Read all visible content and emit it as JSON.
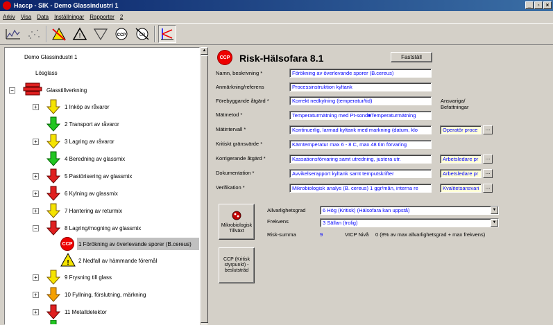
{
  "window": {
    "title": "Haccp - SIK - Demo Glassindustri 1"
  },
  "menu": [
    "Arkiv",
    "Visa",
    "Data",
    "Inställningar",
    "Rapporter",
    "2"
  ],
  "toolbar": {
    "icons": [
      "chart-icon",
      "scatter-icon",
      "no-warning-icon",
      "warning-icon",
      "triangle-icon",
      "ccp-icon",
      "no-ccp-icon",
      "ccp-split-icon"
    ]
  },
  "tree": {
    "root": "Demo Glassindustri 1",
    "product": "Lösglass",
    "process": "Glasstillverkning",
    "steps": [
      {
        "label": "1 Inköp av råvaror",
        "color": "#f5e400"
      },
      {
        "label": "2 Transport av råvaror",
        "color": "#22c622"
      },
      {
        "label": "3 Lagring av råvaror",
        "color": "#f5e400"
      },
      {
        "label": "4 Beredning av glassmix",
        "color": "#22c622"
      },
      {
        "label": "5 Pastörisering av glassmix",
        "color": "#e02020"
      },
      {
        "label": "6 Kylning av glassmix",
        "color": "#e02020"
      },
      {
        "label": "7 Hantering av returmix",
        "color": "#f5e400"
      },
      {
        "label": "8 Lagring/mogning av glassmix",
        "color": "#e02020"
      }
    ],
    "sub_items": [
      {
        "label": "1 Förökning av överlevande sporer (B.cereus)",
        "badge": "CCP"
      },
      {
        "label": "2 Nedfall av hämmande föremål"
      }
    ],
    "more_steps": [
      {
        "label": "9 Frysning till glass",
        "color": "#f5e400"
      },
      {
        "label": "10 Fyllning, förslutning, märkning",
        "color": "#f5a000"
      },
      {
        "label": "11 Metalldetektor",
        "color": "#e02020"
      }
    ]
  },
  "detail": {
    "badge": "CCP",
    "title": "Risk-Hälsofara 8.1",
    "fastall_label": "Fastställ",
    "responsible_label": "Ansvariga/\nBefattningar",
    "fields": [
      {
        "label": "Namn, beskrivning *",
        "value": "Förökning av överlevande sporer (B.cereus)"
      },
      {
        "label": "Anmärkning/referens",
        "value": "Processinstruktion kyltank"
      },
      {
        "label": "Förebyggande åtgärd *",
        "value": "Korrekt nedkylning (temperatur/tid)"
      },
      {
        "label": "Mätmetod *",
        "value": "Temperaturmätning med Pt-sond■Temperaturmätning"
      },
      {
        "label": "Mätintervall *",
        "value": "Kontinuerlig, larmad kyltank med markning (datum, klo",
        "resp": "Operatör proce"
      },
      {
        "label": "Kritiskt gränsvärde *",
        "value": "Kärntemperatur max 6 - 8 C, max 48 tim förvaring"
      },
      {
        "label": "Korrigerande åtgärd *",
        "value": "Kassationsförvaring samt utredning, justera utr.",
        "resp": "Arbetsledare pr"
      },
      {
        "label": "Dokumentation *",
        "value": "Avvikelserapport kyltank samt temputskrifter",
        "resp": "Arbetsledare pr"
      },
      {
        "label": "Verifikation *",
        "value": "Mikrobiologisk analys (B. cereus) 1 ggr/mån, interna re",
        "resp": "Kvalitetsansvari"
      }
    ],
    "mikro_button": "Mikrobiologisk\nTillväxt",
    "ccp_button": "CCP (Kritisk\nstyrpunkt) -\nbeslutsträd",
    "severity_label": "Allvarlighetsgrad",
    "severity_value": "6  Hög (Kritisk)  (Hälsofara kan uppstå)",
    "frequency_label": "Frekvens",
    "frequency_value": "3  Sällan (trolig)",
    "risksum_label": "Risk-summa",
    "risksum_value": "9",
    "vicp_label": "VICP Nivå",
    "vicp_value": "0  (8% av max allvarlighetsgrad + max frekvens)"
  }
}
